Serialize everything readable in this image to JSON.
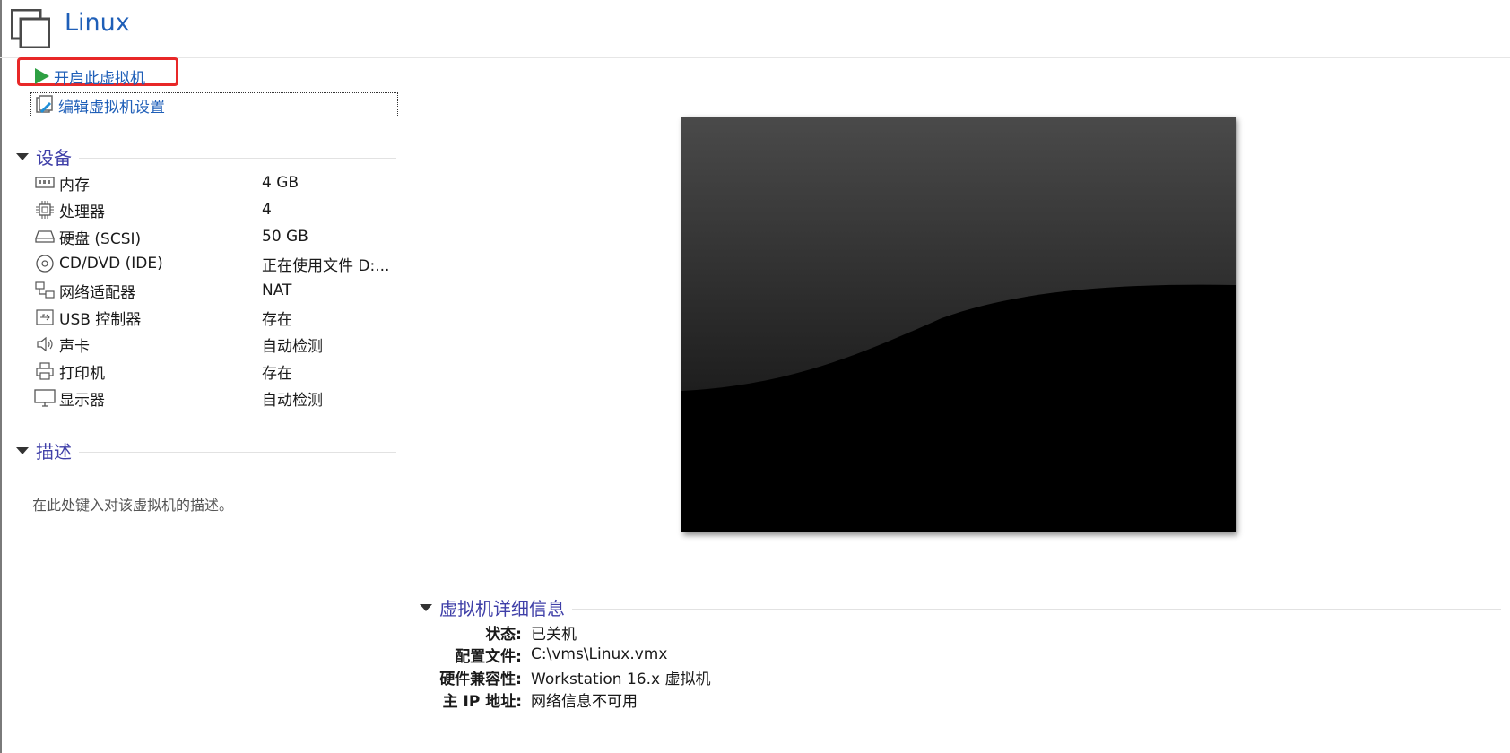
{
  "header": {
    "title": "Linux"
  },
  "actions": {
    "power_on": "开启此虚拟机",
    "edit_settings": "编辑虚拟机设置"
  },
  "devices": {
    "title": "设备",
    "items": [
      {
        "icon": "memory-icon",
        "name": "内存",
        "value": "4 GB"
      },
      {
        "icon": "processor-icon",
        "name": "处理器",
        "value": "4"
      },
      {
        "icon": "harddisk-icon",
        "name": "硬盘 (SCSI)",
        "value": "50 GB"
      },
      {
        "icon": "cdrom-icon",
        "name": "CD/DVD (IDE)",
        "value": "正在使用文件 D:..."
      },
      {
        "icon": "network-adapter-icon",
        "name": "网络适配器",
        "value": "NAT"
      },
      {
        "icon": "usb-icon",
        "name": "USB 控制器",
        "value": "存在"
      },
      {
        "icon": "speaker-icon",
        "name": "声卡",
        "value": "自动检测"
      },
      {
        "icon": "printer-icon",
        "name": "打印机",
        "value": "存在"
      },
      {
        "icon": "monitor-icon",
        "name": "显示器",
        "value": "自动检测"
      }
    ]
  },
  "description": {
    "title": "描述",
    "placeholder": "在此处键入对该虚拟机的描述。"
  },
  "details": {
    "title": "虚拟机详细信息",
    "rows": [
      {
        "key": "状态:",
        "value": "已关机"
      },
      {
        "key": "配置文件:",
        "value": "C:\\vms\\Linux.vmx"
      },
      {
        "key": "硬件兼容性:",
        "value": "Workstation 16.x 虚拟机"
      },
      {
        "key": "主 IP 地址:",
        "value": "网络信息不可用"
      }
    ]
  },
  "colors": {
    "link": "#1f5fb8",
    "section_title": "#3f3fa8",
    "play_green": "#2ea043",
    "highlight_red": "#e82828"
  }
}
